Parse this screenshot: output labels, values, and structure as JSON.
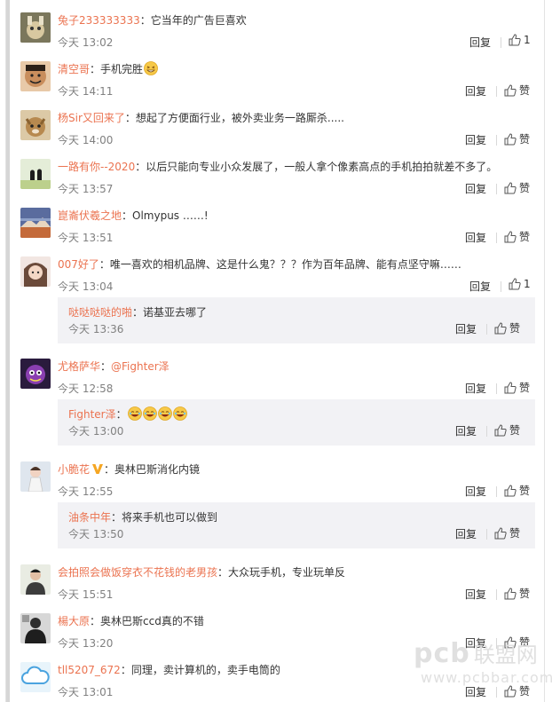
{
  "labels": {
    "reply": "回复",
    "like": "赞"
  },
  "comments": [
    {
      "user": "兔子233333333",
      "text": "：它当年的广告巨喜欢",
      "time": "今天 13:02",
      "likes": "1"
    },
    {
      "user": "清空哥",
      "text": "：手机完胜",
      "time": "今天 14:11",
      "likes": "赞",
      "emoji": "grin"
    },
    {
      "user": "杨Sir又回来了",
      "text": "：想起了方便面行业，被外卖业务一路厮杀.....",
      "time": "今天 14:00",
      "likes": "赞"
    },
    {
      "user": "一路有你--2020",
      "text": "：以后只能向专业小众发展了，一般人拿个像素高点的手机拍拍就差不多了。",
      "time": "今天 13:57",
      "likes": "赞"
    },
    {
      "user": "崑崙伏羲之地",
      "text": "：Olmypus ……!",
      "time": "今天 13:51",
      "likes": "赞"
    },
    {
      "user": "007好了",
      "text": "：唯一喜欢的相机品牌、这是什么鬼？？？作为百年品牌、能有点坚守嘛……",
      "time": "今天 13:04",
      "likes": "1",
      "reply": {
        "user": "哒哒哒哒的啪",
        "text": "：诺基亚去哪了",
        "time": "今天 13:36",
        "likes": "赞"
      }
    },
    {
      "user": "尤格萨华",
      "text": "：",
      "mention": "@Fighter泽",
      "time": "今天 12:58",
      "likes": "赞",
      "reply": {
        "user": "Fighter泽",
        "text": "：",
        "time": "今天 13:00",
        "likes": "赞",
        "emoji_count": 4
      }
    },
    {
      "user": "小脆花",
      "text": "：奥林巴斯消化内镜",
      "time": "今天 12:55",
      "likes": "赞",
      "vip": "V",
      "reply": {
        "user": "油条中年",
        "text": "：将来手机也可以做到",
        "time": "今天 13:50",
        "likes": "赞"
      }
    },
    {
      "user": "会拍照会做饭穿衣不花钱的老男孩",
      "text": "：大众玩手机，专业玩单反",
      "time": "今天 15:51",
      "likes": "赞"
    },
    {
      "user": "楊大原",
      "text": "：奥林巴斯ccd真的不错",
      "time": "今天 13:20",
      "likes": "赞"
    },
    {
      "user": "tll5207_672",
      "text": "：同理，卖计算机的，卖手电筒的",
      "time": "今天 13:01",
      "likes": "赞"
    }
  ],
  "watermark": {
    "logo": "pcb",
    "name": "联盟网",
    "url": "www.pcbbar.com"
  }
}
